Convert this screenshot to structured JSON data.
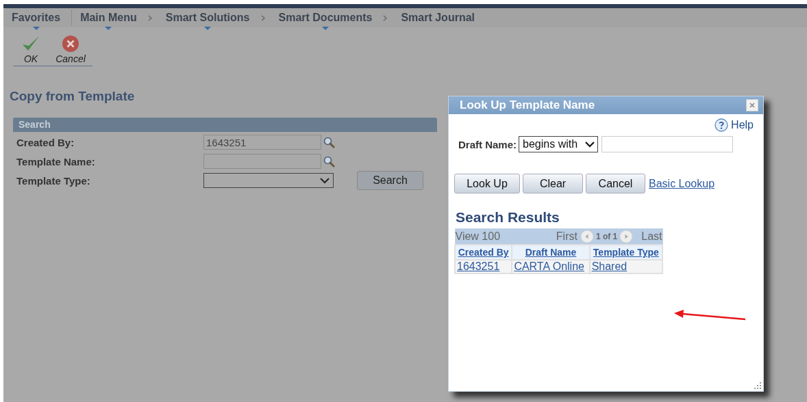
{
  "breadcrumbs": [
    {
      "label": "Favorites",
      "dropdown": true
    },
    {
      "label": "Main Menu",
      "dropdown": true
    },
    {
      "label": "Smart Solutions",
      "dropdown": true
    },
    {
      "label": "Smart Documents",
      "dropdown": true
    },
    {
      "label": "Smart Journal",
      "dropdown": false
    }
  ],
  "toolbar": [
    {
      "label": "OK",
      "kind": "ok"
    },
    {
      "label": "Cancel",
      "kind": "cancel"
    }
  ],
  "page_title": "Copy from Template",
  "search": {
    "header": "Search",
    "fields": [
      {
        "label": "Created By:",
        "kind": "lookup",
        "value": "1643251"
      },
      {
        "label": "Template Name:",
        "kind": "lookup"
      },
      {
        "label": "Template Type:",
        "kind": "select"
      }
    ],
    "button": "Search"
  },
  "dialog": {
    "title": "Look Up Template Name",
    "help": "Help",
    "draft_name": {
      "label": "Draft Name:",
      "operator": "begins with"
    },
    "buttons": [
      "Look Up",
      "Clear",
      "Cancel"
    ],
    "link": "Basic Lookup",
    "results_title": "Search Results",
    "grid": {
      "view": "View 100",
      "first": "First",
      "count": "1 of 1",
      "last": "Last",
      "columns": [
        "Created By",
        "Draft Name",
        "Template Type"
      ],
      "rows": [
        [
          "1643251",
          "CARTA Online",
          "Shared"
        ]
      ]
    }
  }
}
